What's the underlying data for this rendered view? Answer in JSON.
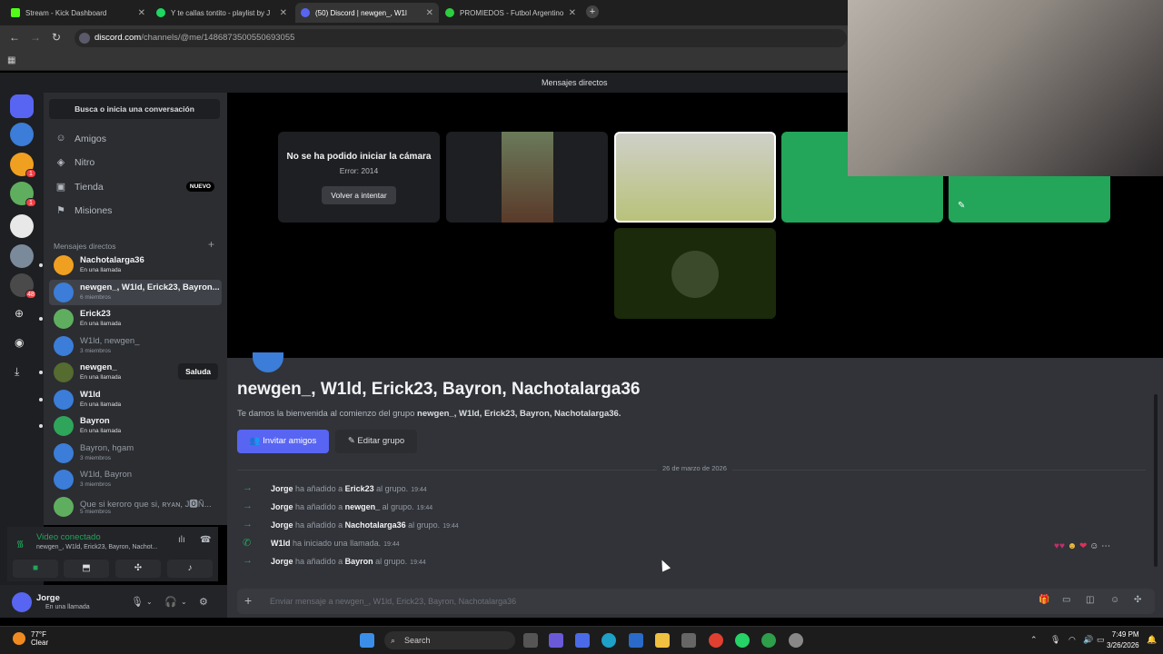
{
  "browser": {
    "tabs": [
      {
        "label": "Stream - Kick Dashboard",
        "color": "#53fc18"
      },
      {
        "label": "Y te callas tontito - playlist by J",
        "color": "#1ed760"
      },
      {
        "label": "(50) Discord | newgen_, W1l",
        "color": "#5865f2"
      },
      {
        "label": "PROMIEDOS - Futbol Argentino",
        "color": "#2ecc40"
      }
    ],
    "url_host": "discord.com",
    "url_path": "/channels/@me/1486873500550693055"
  },
  "topstrip": {
    "title": "Mensajes directos"
  },
  "guild_badges": [
    "1",
    "1",
    "48"
  ],
  "sidebar": {
    "search": "Busca o inicia una conversación",
    "nav": [
      {
        "label": "Amigos",
        "icon": "friends-icon"
      },
      {
        "label": "Nitro",
        "icon": "nitro-icon"
      },
      {
        "label": "Tienda",
        "icon": "store-icon",
        "badge": "NUEVO"
      },
      {
        "label": "Misiones",
        "icon": "quests-icon"
      }
    ],
    "dm_header": "Mensajes directos",
    "dms": [
      {
        "name": "Nachotalarga36",
        "sub": "En una llamada",
        "call": true
      },
      {
        "name": "newgen_, W1ld, Erick23, Bayron...",
        "sub": "6 miembros",
        "call": false
      },
      {
        "name": "Erick23",
        "sub": "En una llamada",
        "call": true
      },
      {
        "name": "W1ld, newgen_",
        "sub": "3 miembros",
        "call": false
      },
      {
        "name": "newgen_",
        "sub": "En una llamada",
        "call": true,
        "wave": "Saluda"
      },
      {
        "name": "W1ld",
        "sub": "En una llamada",
        "call": true
      },
      {
        "name": "Bayron",
        "sub": "En una llamada",
        "call": true
      },
      {
        "name": "Bayron, hgam",
        "sub": "3 miembros",
        "call": false
      },
      {
        "name": "W1ld, Bayron",
        "sub": "3 miembros",
        "call": false
      },
      {
        "name": "Que si keroro que si, ʀʏᴀɴ, J🅾Ñ...",
        "sub": "5 miembros",
        "call": false
      }
    ]
  },
  "voice": {
    "status": "Video conectado",
    "channel": "newgen_, W1ld, Erick23, Bayron, Nachot..."
  },
  "user": {
    "name": "Jorge",
    "status": "En una llamada"
  },
  "call": {
    "camera_error": "No se ha podido iniciar la cámara",
    "error_code": "Error: 2014",
    "retry": "Volver a intentar"
  },
  "chat": {
    "group_title": "newgen_, W1ld, Erick23, Bayron, Nachotalarga36",
    "welcome_prefix": "Te damos la bienvenida al comienzo del grupo",
    "welcome_group": "newgen_, W1ld, Erick23, Bayron, Nachotalarga36.",
    "invite": "Invitar amigos",
    "edit": "Editar grupo",
    "date": "26 de marzo de 2026",
    "messages": [
      {
        "actor": "Jorge",
        "verb": "ha añadido a",
        "target": "Erick23",
        "tail": "al grupo.",
        "time": "19:44",
        "icon": "arrow"
      },
      {
        "actor": "Jorge",
        "verb": "ha añadido a",
        "target": "newgen_",
        "tail": "al grupo.",
        "time": "19:44",
        "icon": "arrow"
      },
      {
        "actor": "Jorge",
        "verb": "ha añadido a",
        "target": "Nachotalarga36",
        "tail": "al grupo.",
        "time": "19:44",
        "icon": "arrow"
      },
      {
        "actor": "W1ld",
        "verb": "ha iniciado una llamada.",
        "target": "",
        "tail": "",
        "time": "19:44",
        "icon": "phone"
      },
      {
        "actor": "Jorge",
        "verb": "ha añadido a",
        "target": "Bayron",
        "tail": "al grupo.",
        "time": "19:44",
        "icon": "arrow"
      }
    ],
    "composer_placeholder": "Enviar mensaje a newgen_, W1ld, Erick23, Bayron, Nachotalarga36"
  },
  "taskbar": {
    "temp": "77°F",
    "weather": "Clear",
    "search": "Search",
    "time": "7:49 PM",
    "date": "3/26/2026"
  },
  "colors": {
    "blurple": "#5865f2",
    "green": "#23a55a",
    "red": "#f23f43"
  }
}
